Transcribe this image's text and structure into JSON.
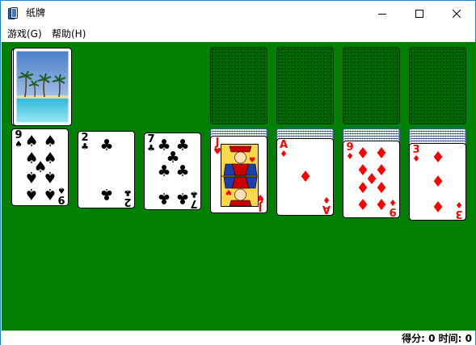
{
  "window": {
    "title": "纸牌",
    "accent_color": "#1883d7"
  },
  "menu": {
    "items": [
      "游戏(G)",
      "帮助(H)"
    ]
  },
  "table": {
    "background_color": "#007f00"
  },
  "stock": {
    "back_design": "palm-beach"
  },
  "foundations": [
    "empty",
    "empty",
    "empty",
    "empty"
  ],
  "tableau": [
    {
      "face_down": 0,
      "top": {
        "rank": "9",
        "suit": "spades"
      }
    },
    {
      "face_down": 0,
      "top": {
        "rank": "2",
        "suit": "clubs"
      }
    },
    {
      "face_down": 0,
      "top": {
        "rank": "7",
        "suit": "clubs"
      }
    },
    {
      "face_down": 3,
      "top": {
        "rank": "J",
        "suit": "hearts"
      }
    },
    {
      "face_down": 4,
      "top": {
        "rank": "A",
        "suit": "diamonds"
      }
    },
    {
      "face_down": 5,
      "top": {
        "rank": "9",
        "suit": "diamonds"
      }
    },
    {
      "face_down": 6,
      "top": {
        "rank": "3",
        "suit": "diamonds"
      }
    }
  ],
  "suit_glyphs": {
    "spades": "♠",
    "clubs": "♣",
    "hearts": "♥",
    "diamonds": "♦"
  },
  "status": {
    "text": "得分: 0 时间: 0"
  }
}
